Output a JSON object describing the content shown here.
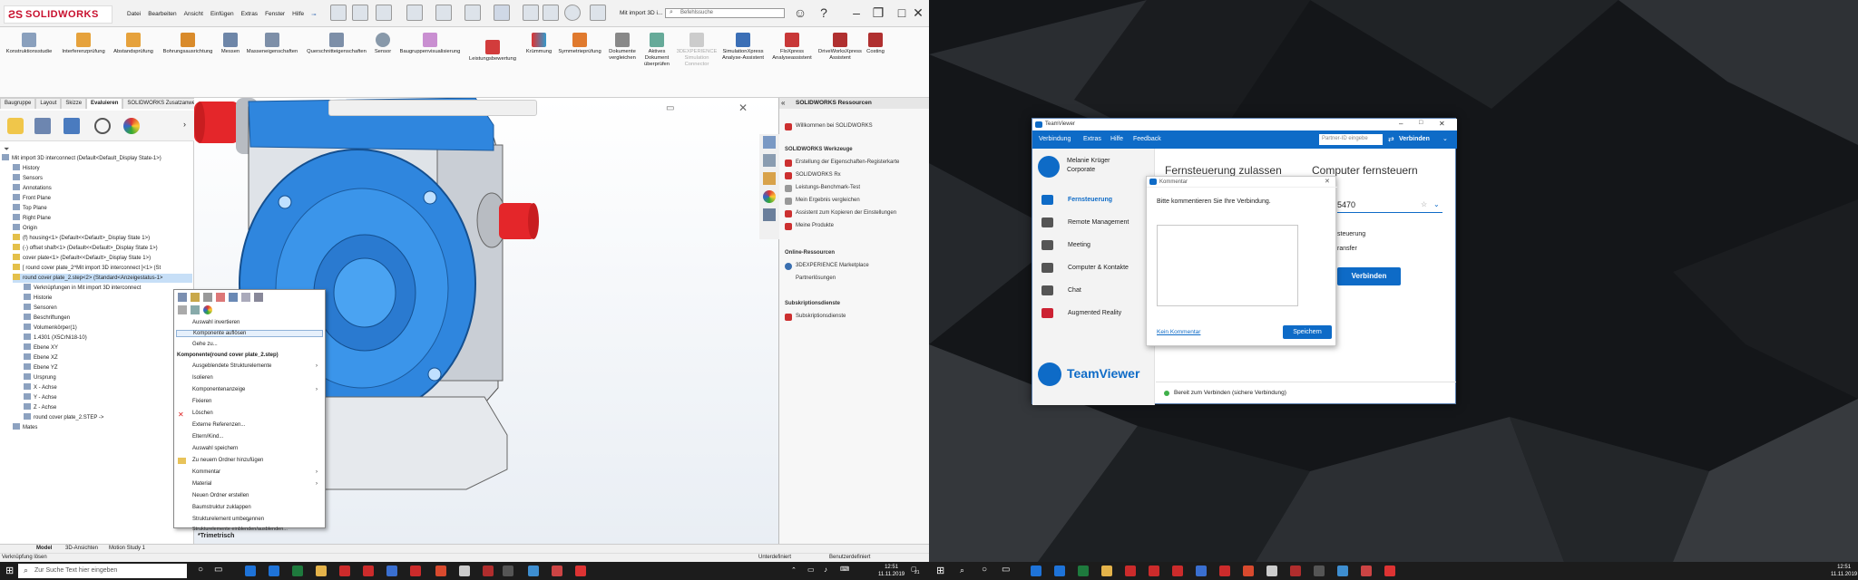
{
  "sw": {
    "brand": "SOLIDWORKS",
    "menus": [
      "Datei",
      "Bearbeiten",
      "Ansicht",
      "Einfügen",
      "Extras",
      "Fenster",
      "Hilfe"
    ],
    "doc_title": "Mit import 3D i...",
    "search_placeholder": "Befehlssuche",
    "commands": [
      [
        "Konstruktionsstudie"
      ],
      [
        "Interferenzprüfung"
      ],
      [
        "Abstandsprüfung"
      ],
      [
        "Bohrungsausrichtung"
      ],
      [
        "Messen"
      ],
      [
        "Masseneigenschaften"
      ],
      [
        "Querschnitteigenschaften"
      ],
      [
        "Sensor"
      ],
      [
        "Baugruppenvisualisierung"
      ],
      [
        "Leistungsbewertung"
      ],
      [
        "Krümmung"
      ],
      [
        "Symmetrieprüfung"
      ],
      [
        "Dokumente",
        "vergleichen"
      ],
      [
        "Aktives",
        "Dokument",
        "überprüfen"
      ],
      [
        "3DEXPERIENCE",
        "Simulation",
        "Connector"
      ],
      [
        "SimulationXpress",
        "Analyse-Assistent"
      ],
      [
        "FloXpress",
        "Analyseassistent"
      ],
      [
        "DriveWorksXpress",
        "Assistent"
      ],
      [
        "Costing"
      ]
    ],
    "tabs": [
      "Baugruppe",
      "Layout",
      "Skizze",
      "Evaluieren",
      "SOLIDWORKS Zusatzanwendungen"
    ],
    "tree_root": "Mit import 3D interconnect  (Default<Default_Display State-1>)",
    "tree": [
      "History",
      "Sensors",
      "Annotations",
      "Front Plane",
      "Top Plane",
      "Right Plane",
      "Origin",
      "(f) housing<1> (Default<<Default>_Display State 1>)",
      "(-) offset shaft<1> (Default<<Default>_Display State 1>)",
      "cover plate<1> (Default<<Default>_Display State 1>)",
      "[ round cover plate_2^Mit import 3D interconnect ]<1> (St",
      "round cover plate_2.step<2> (Standard<Anzeigestatus-1>",
      "Verknüpfungen in Mit import 3D interconnect",
      "Historie",
      "Sensoren",
      "Beschriftungen",
      "Volumenkörper(1)",
      "1.4301 (X5CrNi18-10)",
      "Ebene XY",
      "Ebene XZ",
      "Ebene YZ",
      "Ursprung",
      "X - Achse",
      "Y - Achse",
      "Z - Achse",
      "round cover plate_2.STEP ->",
      "Mates"
    ],
    "context_menu": [
      "Auswahl invertieren",
      "Komponente auflösen",
      "Gehe zu...",
      "Komponente(round cover plate_2.step)",
      "Ausgeblendete Strukturelemente",
      "Isolieren",
      "Komponentenanzeige",
      "Fixieren",
      "Löschen",
      "Externe Referenzen...",
      "Eltern/Kind...",
      "Auswahl speichern",
      "Zu neuem Ordner hinzufügen",
      "Kommentar",
      "Material",
      "Neuen Ordner erstellen",
      "Baumstruktur zuklappen",
      "Strukturelement umbenennen",
      "Strukturelemente einblenden/ausblenden...",
      "»"
    ],
    "view_label": "*Trimetrisch",
    "resources": {
      "title": "SOLIDWORKS Ressourcen",
      "welcome": "Willkommen bei SOLIDWORKS",
      "tools_head": "SOLIDWORKS Werkzeuge",
      "tools": [
        "Erstellung der Eigenschaften-Registerkarte",
        "SOLIDWORKS Rx",
        "Leistungs-Benchmark-Test",
        "Mein Ergebnis vergleichen",
        "Assistent zum Kopieren der Einstellungen",
        "Meine Produkte"
      ],
      "online_head": "Online-Ressourcen",
      "online": [
        "3DEXPERIENCE Marketplace",
        "Partnerlösungen"
      ],
      "sub_head": "Subskriptionsdienste",
      "sub": [
        "Subskriptionsdienste"
      ]
    },
    "bottom_tabs": [
      "Model",
      "3D-Ansichten",
      "Motion Study 1"
    ],
    "status_left": "Verknüpfung lösen",
    "status_mid": "Unterdefiniert",
    "status_right": "Benutzerdefiniert"
  },
  "taskbar": {
    "search_placeholder": "Zur Suche Text hier eingeben",
    "time": "12:51",
    "date": "11.11.2019",
    "badge": "21"
  },
  "teamviewer": {
    "title": "TeamViewer",
    "menu": [
      "Verbindung",
      "Extras",
      "Hilfe",
      "Feedback"
    ],
    "partner_placeholder": "Partner-ID eingebe",
    "connect_label": "Verbinden",
    "user_name": "Melanie Krüger",
    "user_org": "Corporate",
    "nav": [
      "Fernsteuerung",
      "Remote Management",
      "Meeting",
      "Computer & Kontakte",
      "Chat",
      "Augmented Reality"
    ],
    "brand": "TeamViewer",
    "heading_left": "Fernsteuerung zulassen",
    "heading_right": "Computer fernsteuern",
    "partner_id_tail": "5470",
    "opt1": "steuerung",
    "opt2": "ransfer",
    "connect_big": "Verbinden",
    "status": "Bereit zum Verbinden (sichere Verbindung)"
  },
  "comment": {
    "title": "Kommentar",
    "prompt": "Bitte kommentieren Sie Ihre Verbindung.",
    "no_comment": "Kein Kommentar",
    "save": "Speichern"
  }
}
